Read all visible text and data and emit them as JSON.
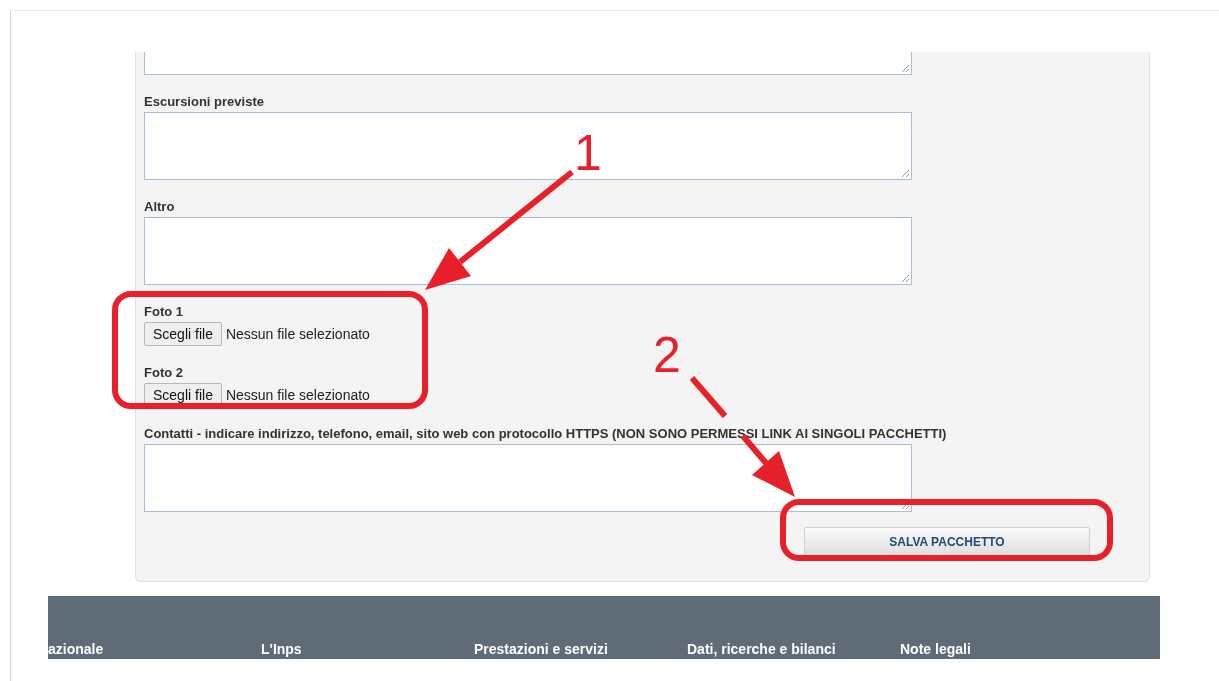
{
  "form": {
    "fields": [
      {
        "kind": "textarea"
      },
      {
        "kind": "textarea",
        "label": "Escursioni previste"
      },
      {
        "kind": "textarea",
        "label": "Altro"
      },
      {
        "kind": "file",
        "label": "Foto 1",
        "button": "Scegli file",
        "status": "Nessun file selezionato"
      },
      {
        "kind": "file",
        "label": "Foto 2",
        "button": "Scegli file",
        "status": "Nessun file selezionato"
      },
      {
        "kind": "textarea",
        "label": "Contatti - indicare indirizzo, telefono, email, sito web con protocollo HTTPS (NON SONO PERMESSI LINK AI SINGOLI PACCHETTI)"
      }
    ],
    "submit": "SALVA PACCHETTO"
  },
  "footer": {
    "links": [
      "azionale",
      "L'Inps",
      "Prestazioni e servizi",
      "Dati, ricerche e bilanci",
      "Note legali"
    ]
  },
  "annotations": [
    {
      "number": "1"
    },
    {
      "number": "2"
    }
  ]
}
